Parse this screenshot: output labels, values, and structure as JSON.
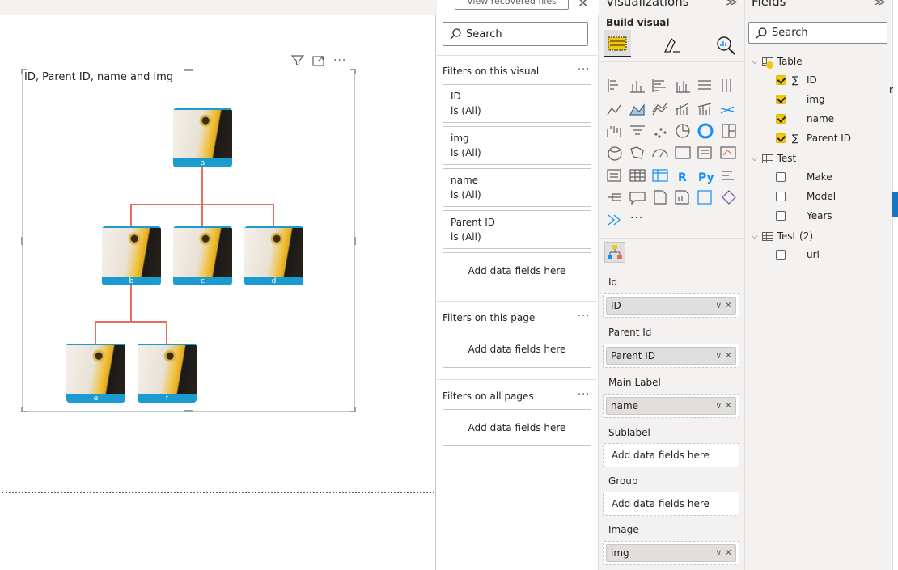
{
  "top": {
    "recovered_label": "View recovered files",
    "close_glyph": "✕"
  },
  "visual": {
    "title": "ID, Parent ID, name and img",
    "nodes": [
      {
        "id": "a",
        "label": "a"
      },
      {
        "id": "b",
        "label": "b"
      },
      {
        "id": "c",
        "label": "c"
      },
      {
        "id": "d",
        "label": "d"
      },
      {
        "id": "e",
        "label": "e"
      },
      {
        "id": "f",
        "label": "f"
      }
    ]
  },
  "filters": {
    "search_placeholder": "Search",
    "on_visual_label": "Filters on this visual",
    "cards": [
      {
        "field": "ID",
        "value": "is (All)"
      },
      {
        "field": "img",
        "value": "is (All)"
      },
      {
        "field": "name",
        "value": "is (All)"
      },
      {
        "field": "Parent ID",
        "value": "is (All)"
      }
    ],
    "add_fields": "Add data fields here",
    "on_page_label": "Filters on this page",
    "on_all_label": "Filters on all pages",
    "more": "···"
  },
  "viz": {
    "title": "Visualizations",
    "collapse": "≫",
    "build_visual": "Build visual",
    "more_visuals": "···",
    "wells": [
      {
        "label": "Id",
        "value": "ID"
      },
      {
        "label": "Parent Id",
        "value": "Parent ID"
      },
      {
        "label": "Main Label",
        "value": "name"
      },
      {
        "label": "Sublabel",
        "value": ""
      },
      {
        "label": "Group",
        "value": ""
      },
      {
        "label": "Image",
        "value": "img"
      }
    ],
    "add_fields": "Add data fields here",
    "pill_ctl": "∨ ✕"
  },
  "fields": {
    "title": "Fields",
    "collapse": "≫",
    "search_placeholder": "Search",
    "tables": [
      {
        "name": "Table",
        "items": [
          {
            "name": "ID",
            "sigma": true,
            "checked": true
          },
          {
            "name": "img",
            "sigma": false,
            "checked": true
          },
          {
            "name": "name",
            "sigma": false,
            "checked": true
          },
          {
            "name": "Parent ID",
            "sigma": true,
            "checked": true
          }
        ]
      },
      {
        "name": "Test",
        "items": [
          {
            "name": "Make",
            "sigma": false,
            "checked": false
          },
          {
            "name": "Model",
            "sigma": false,
            "checked": false
          },
          {
            "name": "Years",
            "sigma": false,
            "checked": false
          }
        ]
      },
      {
        "name": "Test (2)",
        "items": [
          {
            "name": "url",
            "sigma": false,
            "checked": false
          }
        ]
      }
    ],
    "edge_mark": "r"
  },
  "colors": {
    "accent": "#f2c811",
    "node": "#1c9bd0",
    "connector": "#e66c5f",
    "edge_bar": "#1976c2"
  }
}
